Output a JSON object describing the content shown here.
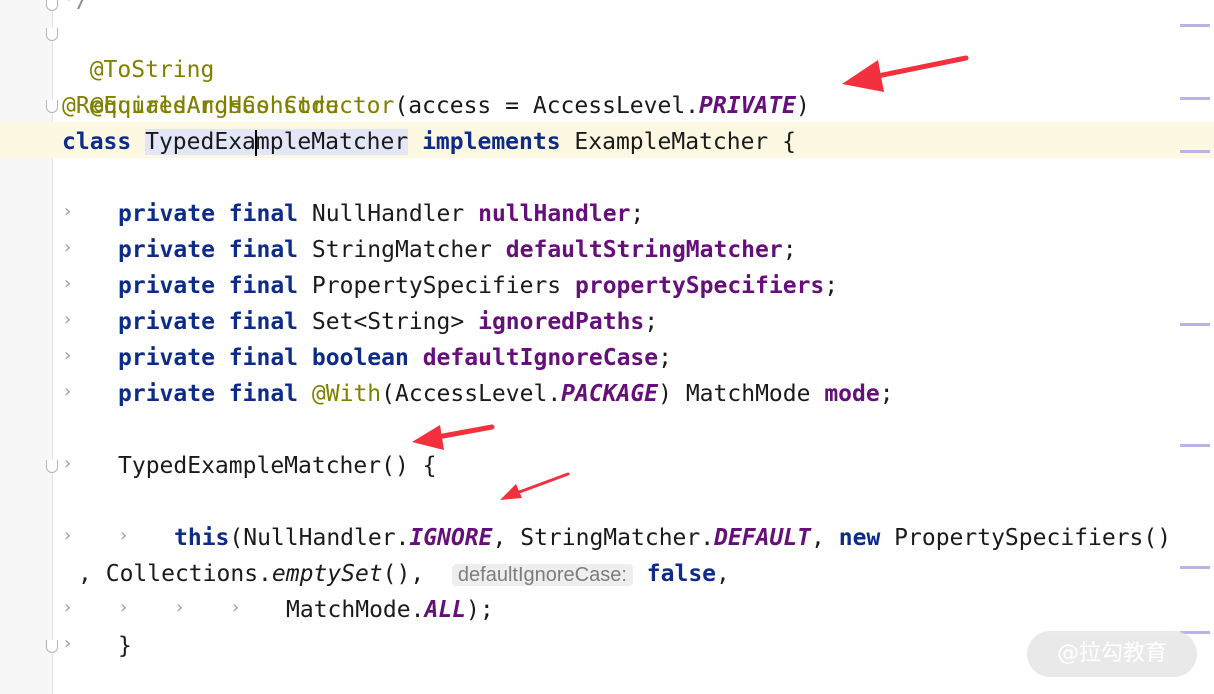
{
  "editor": {
    "lines": {
      "l0": "*/",
      "l1_anno": "@ToString",
      "l2_anno": "@EqualsAndHashCode",
      "l3_anno": "@RequiredArgsConstructor",
      "l3_open": "(access",
      "l3_eq": "=",
      "l3_type": "AccessLevel.",
      "l3_const": "PRIVATE",
      "l3_close": ")",
      "l4_kw_class": "class",
      "l4_name_a": "TypedExa",
      "l4_name_b": "mpleMatcher",
      "l4_kw_impl": "implements",
      "l4_iface": "ExampleMatcher",
      "l4_brace": "{"
    },
    "fields": [
      {
        "mod1": "private",
        "mod2": "final",
        "type": "NullHandler",
        "name": "nullHandler",
        "end": ";"
      },
      {
        "mod1": "private",
        "mod2": "final",
        "type": "StringMatcher",
        "name": "defaultStringMatcher",
        "end": ";"
      },
      {
        "mod1": "private",
        "mod2": "final",
        "type": "PropertySpecifiers",
        "name": "propertySpecifiers",
        "end": ";"
      },
      {
        "mod1": "private",
        "mod2": "final",
        "type": "Set<String>",
        "name": "ignoredPaths",
        "end": ";"
      },
      {
        "mod1": "private",
        "mod2": "final",
        "type": "boolean",
        "name": "defaultIgnoreCase",
        "end": ";"
      }
    ],
    "field6": {
      "mod1": "private",
      "mod2": "final",
      "anno": "@With",
      "args_a": "(AccessLevel.",
      "args_const": "PACKAGE",
      "args_b": ")",
      "type": "MatchMode",
      "name": "mode",
      "end": ";"
    },
    "ctor": {
      "name": "TypedExampleMatcher()",
      "brace": "{"
    },
    "call": {
      "kw_this": "this",
      "p1": "(NullHandler.",
      "c1": "IGNORE",
      "comma1": ",",
      "p2": "StringMatcher.",
      "c2": "DEFAULT",
      "comma2": ",",
      "kw_new": "new",
      "p3": "PropertySpecifiers()"
    },
    "cont": {
      "lead": ",",
      "p4": "Collections.",
      "m4": "emptySet",
      "p5": "(),",
      "hint": "defaultIgnoreCase:",
      "kw_false": "false",
      "comma": ","
    },
    "last": {
      "p6": "MatchMode.",
      "c6": "ALL",
      "end": ");"
    },
    "close": "}"
  },
  "icons": {
    "fold": "fold-arrow-icon",
    "annotation": "red-arrow-annotation"
  },
  "colors": {
    "keyword": "#0d2b88",
    "field": "#660e7a",
    "annotation": "#808000",
    "arrow": "#f2303e"
  },
  "watermark": "@拉勾教育"
}
